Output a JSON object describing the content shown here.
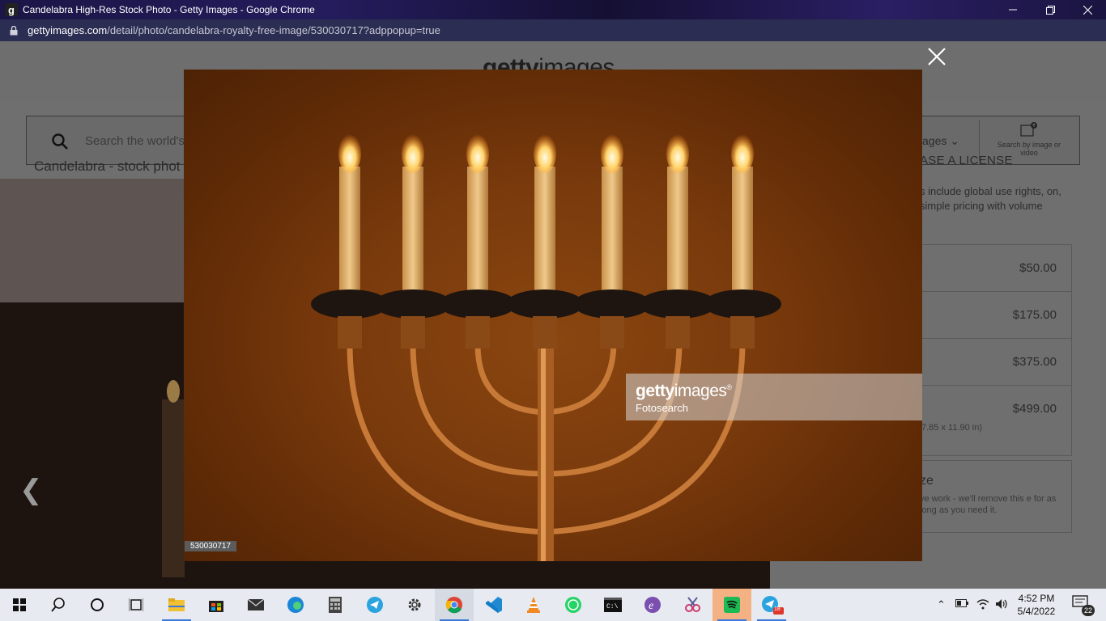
{
  "window": {
    "favicon": "g",
    "title": "Candelabra High-Res Stock Photo - Getty Images - Google Chrome",
    "controls": [
      "minimize-icon",
      "restore-icon",
      "close-icon"
    ]
  },
  "address": {
    "domain": "gettyimages.com",
    "path": "/detail/photo/candelabra-royalty-free-image/530030717?adppopup=true"
  },
  "page": {
    "logo_bold": "getty",
    "logo_light": "images",
    "search_placeholder": "Search the world's",
    "filter_label": "ages",
    "by_image_label": "Search by image or video",
    "stock_title": "Candelabra - stock phot",
    "license_title": "ASE A LICENSE",
    "license_desc": "s include global use rights, on, simple pricing with volume",
    "sizes": [
      {
        "price": "$50.00",
        "dims": ""
      },
      {
        "price": "$175.00",
        "dims": ""
      },
      {
        "price": "$375.00",
        "dims": ""
      },
      {
        "price": "$499.00",
        "dims": "7.85 x 11.90 in)"
      }
    ],
    "custom_title": "ze",
    "custom_desc": "ve work - we'll remove this e for as long as you need it."
  },
  "overlay": {
    "watermark_bold": "getty",
    "watermark_light": "images",
    "watermark_mark": "®",
    "credit": "Fotosearch",
    "image_id": "530030717"
  },
  "taskbar": {
    "apps": [
      "windows-start-icon",
      "search-icon",
      "cortana-icon",
      "task-view-icon",
      "file-explorer-icon",
      "microsoft-store-icon",
      "mail-icon",
      "edge-icon",
      "calculator-icon",
      "telegram-icon",
      "settings-icon",
      "chrome-icon",
      "vscode-icon",
      "vlc-icon",
      "whatsapp-icon",
      "terminal-icon",
      "emacs-icon",
      "snipping-icon",
      "spotify-icon",
      "telegram-badge-icon"
    ],
    "telegram_badge": "18",
    "time": "4:52 PM",
    "date": "5/4/2022",
    "notifications": "22"
  }
}
